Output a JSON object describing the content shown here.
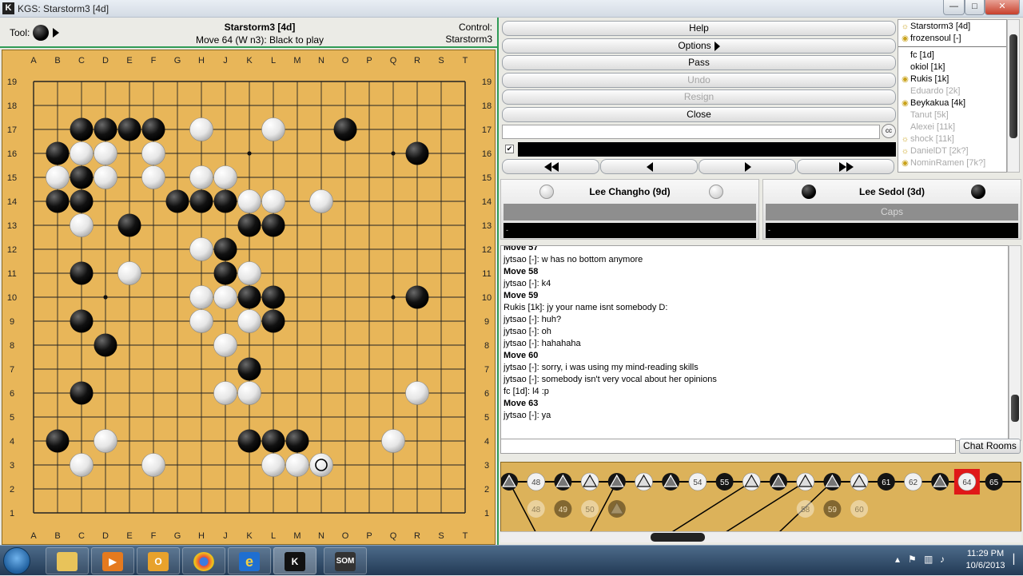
{
  "window": {
    "title": "KGS: Starstorm3 [4d]",
    "minimize": "—",
    "maximize": "□",
    "close": "✕",
    "app_icon": "K"
  },
  "header": {
    "tool_label": "Tool:",
    "player": "Starstorm3 [4d]",
    "move_status": "Move 64 (W n3): Black to play",
    "control_label": "Control:",
    "control_value": "Starstorm3"
  },
  "board": {
    "size": 19,
    "columns": [
      "A",
      "B",
      "C",
      "D",
      "E",
      "F",
      "G",
      "H",
      "J",
      "K",
      "L",
      "M",
      "N",
      "O",
      "P",
      "Q",
      "R",
      "S",
      "T"
    ],
    "black_stones": [
      "C17",
      "D17",
      "E17",
      "F17",
      "O17",
      "B16",
      "R16",
      "C15",
      "B14",
      "C14",
      "G14",
      "H14",
      "J14",
      "E13",
      "K13",
      "L13",
      "J12",
      "C11",
      "J11",
      "K10",
      "L10",
      "R10",
      "C9",
      "L9",
      "D8",
      "K7",
      "C6",
      "B4",
      "K4",
      "L4",
      "M4"
    ],
    "white_stones": [
      "H17",
      "L17",
      "C16",
      "D16",
      "F16",
      "B15",
      "D15",
      "F15",
      "H15",
      "J15",
      "K14",
      "L14",
      "N14",
      "C13",
      "H12",
      "E11",
      "K11",
      "H10",
      "J10",
      "H9",
      "K9",
      "J8",
      "J6",
      "K6",
      "R6",
      "D4",
      "Q4",
      "C3",
      "F3",
      "L3",
      "M3",
      "N3"
    ],
    "last_move": "N3",
    "hoshi": [
      "D4",
      "K4",
      "Q4",
      "D10",
      "K10",
      "Q10",
      "D16",
      "K16",
      "Q16"
    ]
  },
  "controls": {
    "help": "Help",
    "options": "Options",
    "pass": "Pass",
    "undo": "Undo",
    "resign": "Resign",
    "close": "Close",
    "checkbox_mark": "✔",
    "cc_icon": "cc",
    "nav_first_icon": "double-left-arrow",
    "nav_prev_icon": "left-arrow",
    "nav_next_icon": "right-arrow",
    "nav_last_icon": "double-right-arrow"
  },
  "players_list": [
    {
      "name": "Starstorm3 [4d]",
      "icon": "sun",
      "away": false
    },
    {
      "name": "frozensoul [-]",
      "icon": "eye",
      "away": false
    },
    {
      "name": "fc [1d]",
      "icon": "",
      "away": false
    },
    {
      "name": "okiol [1k]",
      "icon": "",
      "away": false
    },
    {
      "name": "Rukis [1k]",
      "icon": "eye",
      "away": false
    },
    {
      "name": "Eduardo [2k]",
      "icon": "",
      "away": true
    },
    {
      "name": "Beykakua [4k]",
      "icon": "eye",
      "away": false
    },
    {
      "name": "Tanut [5k]",
      "icon": "",
      "away": true
    },
    {
      "name": "Alexei [11k]",
      "icon": "",
      "away": true
    },
    {
      "name": "shock [11k]",
      "icon": "sun",
      "away": true
    },
    {
      "name": "DanielDT [2k?]",
      "icon": "sun",
      "away": true
    },
    {
      "name": "NominRamen [7k?]",
      "icon": "eye",
      "away": true
    }
  ],
  "white_player": {
    "name": "Lee Changho (9d)",
    "clock": "-"
  },
  "black_player": {
    "name": "Lee Sedol (3d)",
    "status": "Caps",
    "clock": "-"
  },
  "chat": [
    {
      "text": "Move 57",
      "bold": true
    },
    {
      "text": "jytsao [-]: w has no bottom anymore",
      "bold": false
    },
    {
      "text": "Move 58",
      "bold": true
    },
    {
      "text": "jytsao [-]: k4",
      "bold": false
    },
    {
      "text": "Move 59",
      "bold": true
    },
    {
      "text": "Rukis [1k]: jy your name isnt somebody D:",
      "bold": false
    },
    {
      "text": "jytsao [-]: huh?",
      "bold": false
    },
    {
      "text": "jytsao [-]: oh",
      "bold": false
    },
    {
      "text": "jytsao [-]: hahahaha",
      "bold": false
    },
    {
      "text": "Move 60",
      "bold": true
    },
    {
      "text": "jytsao [-]: sorry, i was using my mind-reading skills",
      "bold": false
    },
    {
      "text": "jytsao [-]: somebody isn't very vocal about her opinions",
      "bold": false
    },
    {
      "text": "fc [1d]: l4 :p",
      "bold": false
    },
    {
      "text": "Move 63",
      "bold": true
    },
    {
      "text": "jytsao [-]: ya",
      "bold": false
    }
  ],
  "chat_rooms_button": "Chat Rooms",
  "move_tree": {
    "main_line": [
      {
        "kind": "tri-b",
        "label": ""
      },
      {
        "kind": "w",
        "label": "48"
      },
      {
        "kind": "tri-b",
        "label": ""
      },
      {
        "kind": "tri-w",
        "label": ""
      },
      {
        "kind": "tri-b",
        "label": ""
      },
      {
        "kind": "tri-w",
        "label": ""
      },
      {
        "kind": "tri-b",
        "label": ""
      },
      {
        "kind": "w",
        "label": "54"
      },
      {
        "kind": "b",
        "label": "55"
      },
      {
        "kind": "tri-w",
        "label": ""
      },
      {
        "kind": "tri-b",
        "label": ""
      },
      {
        "kind": "tri-w",
        "label": ""
      },
      {
        "kind": "tri-b",
        "label": ""
      },
      {
        "kind": "tri-w",
        "label": ""
      },
      {
        "kind": "b",
        "label": "61"
      },
      {
        "kind": "w",
        "label": "62"
      },
      {
        "kind": "tri-b",
        "label": ""
      },
      {
        "kind": "w",
        "label": "64",
        "current": true
      },
      {
        "kind": "b",
        "label": "65"
      }
    ],
    "variations": [
      {
        "kind": "w",
        "label": "48"
      },
      {
        "kind": "b",
        "label": "49"
      },
      {
        "kind": "w",
        "label": "50"
      },
      {
        "kind": "tri-b",
        "label": ""
      },
      {
        "kind": "w",
        "label": "58"
      },
      {
        "kind": "b",
        "label": "59"
      },
      {
        "kind": "w",
        "label": "60"
      }
    ]
  },
  "taskbar": {
    "apps": [
      "explorer",
      "media-player",
      "outlook",
      "chrome",
      "internet-explorer",
      "kgs",
      "som"
    ],
    "time": "11:29 PM",
    "date": "10/6/2013"
  }
}
